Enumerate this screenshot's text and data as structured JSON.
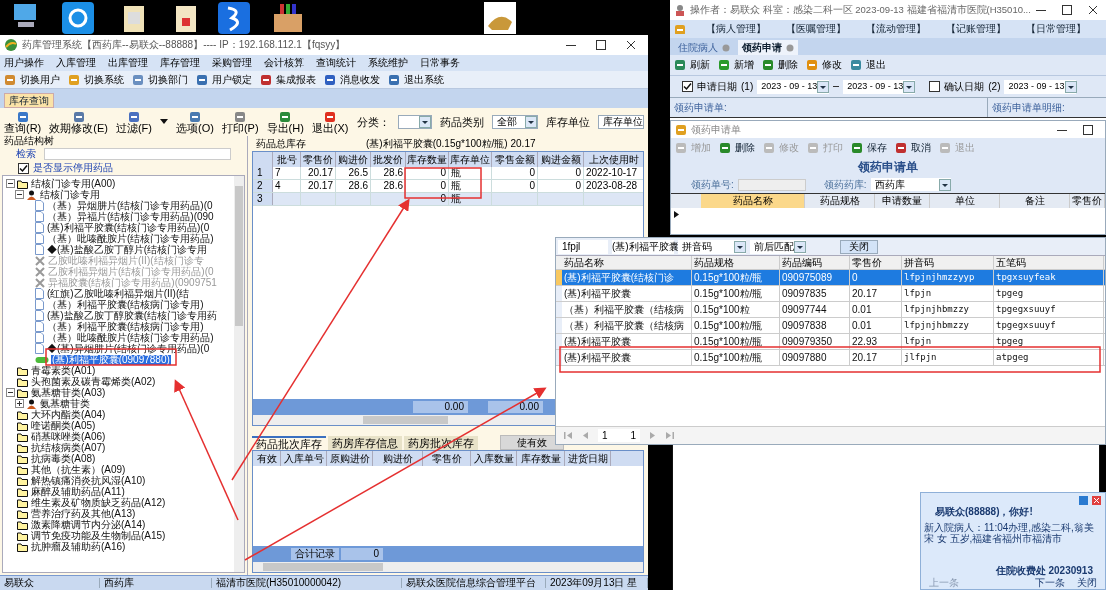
{
  "main_window": {
    "title": "药库管理系统【西药库--易联众--88888】---- IP：192.168.112.1【fqsyy】",
    "menu": [
      "用户操作",
      "入库管理",
      "出库管理",
      "库存管理",
      "采购管理",
      "会计核算",
      "查询统计",
      "系统维护",
      "日常事务"
    ],
    "toolbar": [
      "切换用户",
      "切换系统",
      "切换部门",
      "用户锁定",
      "集成报表",
      "消息收发",
      "退出系统"
    ],
    "tabs": [
      {
        "label": "库存查询",
        "selected": true
      }
    ],
    "query_buttons": [
      "查询(R)",
      "效期修改(E)",
      "过滤(F)",
      "选项(O)",
      "打印(P)",
      "导出(H)",
      "退出(X)"
    ],
    "category_label": "分类：",
    "drug_type_label": "药品类别",
    "drug_type_value": "全部",
    "stock_unit_label": "库存单位",
    "stock_unit_value": "库存单位",
    "tree": {
      "title": "药品结构树",
      "search_label": "检索",
      "show_disabled": {
        "label": "是否显示停用药品",
        "checked": true
      },
      "nodes": [
        {
          "label": "结核门诊专用(A00)",
          "kind": "folder",
          "selected": false,
          "expanded": true,
          "children": [
            {
              "label": "结核门诊专用",
              "kind": "group",
              "selected": false,
              "expanded": true,
              "children": [
                {
                  "label": "（基）异烟肼片(结核门诊专用药品)(0",
                  "kind": "document",
                  "selected": false
                },
                {
                  "label": "（基）异福片(结核门诊专用药品)(090",
                  "kind": "document",
                  "selected": false
                },
                {
                  "label": "(基)利福平胶囊(结核门诊专用药品)(0",
                  "kind": "document",
                  "selected": false
                },
                {
                  "label": "（基）吡嗪酰胺片(结核门诊专用药品)",
                  "kind": "document",
                  "selected": false
                },
                {
                  "label": "◆(基)盐酸乙胺丁醇片(结核门诊专用",
                  "kind": "document",
                  "selected": false
                },
                {
                  "label": "乙胺吡嗪利福异烟片(II)(结核门诊专",
                  "kind": "stopped",
                  "selected": false
                },
                {
                  "label": "乙胺利福异烟片(结核门诊专用药品)(0",
                  "kind": "stopped",
                  "selected": false
                },
                {
                  "label": "异福胶囊(结核门诊专用药品)(0909751",
                  "kind": "stopped",
                  "selected": false
                },
                {
                  "label": "(红旗)乙胺吡嗪利福异烟片(II)(结",
                  "kind": "document",
                  "selected": false
                },
                {
                  "label": "（基）利福平胶囊(结核病门诊专用)",
                  "kind": "document",
                  "selected": false
                },
                {
                  "label": "(基)盐酸乙胺丁醇胶囊(结核门诊专用药",
                  "kind": "document",
                  "selected": false
                },
                {
                  "label": "（基）利福平胶囊(结核病门诊专用)",
                  "kind": "document",
                  "selected": false
                },
                {
                  "label": "（基）吡嗪酰胺片(结核门诊专用药品)",
                  "kind": "document",
                  "selected": false
                },
                {
                  "label": "◆(基)异烟肼片(结核门诊专用药品)(0",
                  "kind": "document",
                  "selected": false
                },
                {
                  "label": "(基)利福平胶囊(09097880)",
                  "kind": "capsule",
                  "selected": true
                }
              ]
            }
          ]
        },
        {
          "label": "青霉素类(A01)",
          "kind": "folder",
          "selected": false
        },
        {
          "label": "头孢菌素及碳青霉烯类(A02)",
          "kind": "folder",
          "selected": false
        },
        {
          "label": "氨基糖苷类(A03)",
          "kind": "folder",
          "selected": false,
          "expanded": true,
          "children": [
            {
              "label": "氨基糖苷类",
              "kind": "group",
              "selected": false,
              "expanded": false
            }
          ]
        },
        {
          "label": "大环内酯类(A04)",
          "kind": "folder",
          "selected": false
        },
        {
          "label": "喹诺酮类(A05)",
          "kind": "folder",
          "selected": false
        },
        {
          "label": "硝基咪唑类(A06)",
          "kind": "folder",
          "selected": false
        },
        {
          "label": "抗结核病类(A07)",
          "kind": "folder",
          "selected": false
        },
        {
          "label": "抗病毒类(A08)",
          "kind": "folder",
          "selected": false
        },
        {
          "label": "其他（抗生素）(A09)",
          "kind": "folder",
          "selected": false
        },
        {
          "label": "解热镇痛消炎抗风湿(A10)",
          "kind": "folder",
          "selected": false
        },
        {
          "label": "麻醉及辅助药品(A11)",
          "kind": "folder",
          "selected": false
        },
        {
          "label": "维生素及矿物质缺乏药品(A12)",
          "kind": "folder",
          "selected": false
        },
        {
          "label": "营养治疗药及其他(A13)",
          "kind": "folder",
          "selected": false
        },
        {
          "label": "激素降糖调节内分泌(A14)",
          "kind": "folder",
          "selected": false
        },
        {
          "label": "调节免疫功能及生物制品(A15)",
          "kind": "folder",
          "selected": false
        },
        {
          "label": "抗肿瘤及辅助药(A16)",
          "kind": "folder",
          "selected": false
        }
      ]
    },
    "stock": {
      "title": "药品总库存",
      "summary": "(基)利福平胶囊(0.15g*100粒/瓶) 20.17",
      "columns": [
        "批号",
        "零售价",
        "购进价",
        "批发价",
        "库存数量",
        "库存单位",
        "零售金额",
        "购进金额",
        "上次使用时"
      ],
      "rows": [
        {
          "number": "1",
          "cells": [
            "7",
            "20.17",
            "26.5",
            "28.6",
            "0",
            "瓶",
            "0",
            "0",
            "2022-10-17"
          ]
        },
        {
          "number": "2",
          "cells": [
            "4",
            "20.17",
            "28.6",
            "28.6",
            "0",
            "瓶",
            "0",
            "0",
            "2023-08-28"
          ]
        },
        {
          "number": "3",
          "cells": [
            "",
            "",
            "",
            "",
            "0",
            "瓶",
            "",
            "",
            ""
          ]
        }
      ],
      "totals": [
        "0.00",
        "0.00"
      ]
    },
    "batch_tabs": [
      {
        "label": "药品批次库存",
        "selected": true
      },
      {
        "label": "药房库存信息",
        "selected": false
      },
      {
        "label": "药房批次库存",
        "selected": false
      }
    ],
    "valid_button": "使有效",
    "batch_columns": [
      "有效",
      "入库单号",
      "原购进价",
      "购进价",
      "零售价",
      "入库数量",
      "库存数量",
      "进货日期"
    ],
    "total_label": "合计记录",
    "total_value": "0",
    "status_bar": [
      "易联众",
      "西药库",
      "福清市医院(H35010000042)",
      "易联众医院信息综合管理平台",
      "2023年09月13日 星"
    ]
  },
  "ward_window": {
    "title": "操作者：易联众 科室：感染二科一区 2023-09-13 福建省福清市医院(H35010...",
    "menu": [
      "【病人管理】",
      "【医嘱管理】",
      "【流动管理】",
      "【记账管理】",
      "【日常管理】"
    ],
    "tabs": [
      {
        "label": "住院病人",
        "selected": false
      },
      {
        "label": "领药申请",
        "selected": true
      }
    ],
    "toolbar": [
      "刷新",
      "新增",
      "删除",
      "修改",
      "退出"
    ],
    "apply_date": {
      "label": "申请日期",
      "index": "(1)",
      "checked": true,
      "from": "2023 - 09 - 13",
      "to": "2023 - 09 - 13"
    },
    "confirm_date": {
      "label": "确认日期",
      "index": "(2)",
      "checked": false,
      "from": "2023 - 09 - 13"
    },
    "list_label": "领药申请单:",
    "detail_label": "领药申请单明细:"
  },
  "request_form": {
    "title": "领药申请单",
    "toolbar": [
      {
        "label": "增加",
        "disabled": true
      },
      {
        "label": "删除",
        "disabled": false
      },
      {
        "label": "修改",
        "disabled": true
      },
      {
        "label": "打印",
        "disabled": true
      },
      {
        "label": "保存",
        "disabled": false
      },
      {
        "label": "取消",
        "disabled": false
      },
      {
        "label": "退出",
        "disabled": true
      }
    ],
    "heading": "领药申请单",
    "number_label": "领药单号:",
    "store_label": "领药药库:",
    "store_value": "西药库",
    "columns": [
      "药品名称",
      "药品规格",
      "申请数量",
      "单位",
      "备注",
      "零售价"
    ]
  },
  "search_popup": {
    "query": "1fpjl",
    "name": "(基)利福平胶囊",
    "mode": "拼音码",
    "match": "前后匹配",
    "close_button": "关闭",
    "columns": [
      "药品名称",
      "药品规格",
      "药品编码",
      "零售价",
      "拼音码",
      "五笔码"
    ],
    "rows": [
      {
        "selected": true,
        "cells": [
          "(基)利福平胶囊(结核门诊",
          "0.15g*100粒/瓶",
          "090975089",
          "0",
          "lfpjnjhmzzyyp",
          "tpgxsuyfeak"
        ]
      },
      {
        "selected": false,
        "cells": [
          "(基)利福平胶囊",
          "0.15g*100粒/瓶",
          "09097835",
          "20.17",
          "lfpjn",
          "tpgeg"
        ]
      },
      {
        "selected": false,
        "cells": [
          "（基）利福平胶囊（结核病",
          "0.15g*100粒",
          "09097744",
          "0.01",
          "lfpjnjhbmzzy",
          "tpgegxsuuyf"
        ]
      },
      {
        "selected": false,
        "cells": [
          "（基）利福平胶囊（结核病",
          "0.15g*100粒/瓶",
          "09097838",
          "0.01",
          "lfpjnjhbmzzy",
          "tpgegxsuuyf"
        ]
      },
      {
        "selected": false,
        "cells": [
          "(基)利福平胶囊",
          "0.15g*100粒/瓶",
          "090979350",
          "22.93",
          "lfpjn",
          "tpgeg"
        ]
      },
      {
        "selected": false,
        "cells": [
          "(基)利福平胶囊",
          "0.15g*100粒/瓶",
          "09097880",
          "20.17",
          "jlfpjn",
          "atpgeg"
        ]
      }
    ],
    "page": "1",
    "page_count": "1"
  },
  "notification": {
    "greeting": "易联众(88888)，你好!",
    "message": "新入院病人：11:04办理,感染二科,翁美宋 女 五岁,福建省福州市福清市",
    "sender": "住院收费处 20230913",
    "links": [
      "上一条",
      "下一条",
      "关闭"
    ]
  }
}
